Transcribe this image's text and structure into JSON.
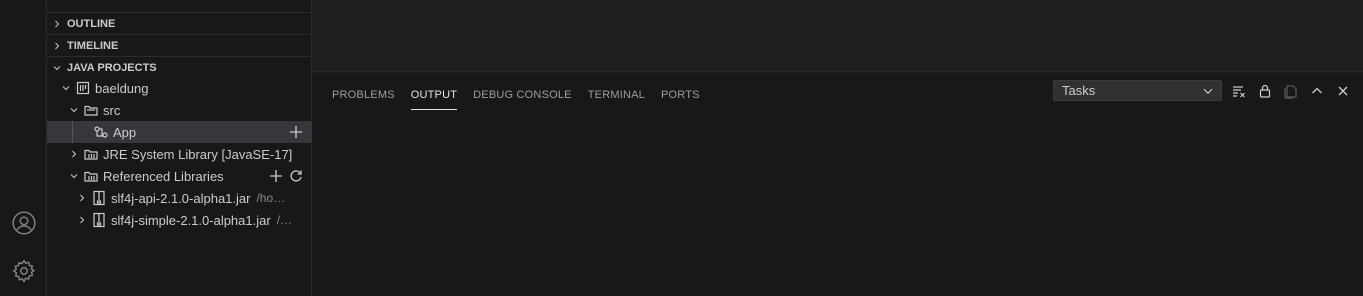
{
  "sidebar": {
    "sections": {
      "outline": "OUTLINE",
      "timeline": "TIMELINE",
      "java_projects": "JAVA PROJECTS"
    },
    "tree": {
      "project": "baeldung",
      "src": "src",
      "app": "App",
      "jre": "JRE System Library [JavaSE-17]",
      "ref_libs": "Referenced Libraries",
      "jar1": {
        "name": "slf4j-api-2.1.0-alpha1.jar",
        "path": "/ho…"
      },
      "jar2": {
        "name": "slf4j-simple-2.1.0-alpha1.jar",
        "path": "/…"
      }
    }
  },
  "panel": {
    "tabs": [
      "PROBLEMS",
      "OUTPUT",
      "DEBUG CONSOLE",
      "TERMINAL",
      "PORTS"
    ],
    "active_tab": "OUTPUT",
    "channel_select": "Tasks",
    "actions": [
      "clear-output-icon",
      "lock-scroll-icon",
      "open-in-editor-icon",
      "maximize-panel-icon",
      "close-panel-icon"
    ]
  },
  "activity_bar": {
    "icons": [
      "account-icon",
      "manage-gear-icon"
    ]
  },
  "colors": {
    "background": "#1f1f1f",
    "sidebar": "#181818",
    "selection": "#37373d",
    "text": "#cccccc"
  }
}
